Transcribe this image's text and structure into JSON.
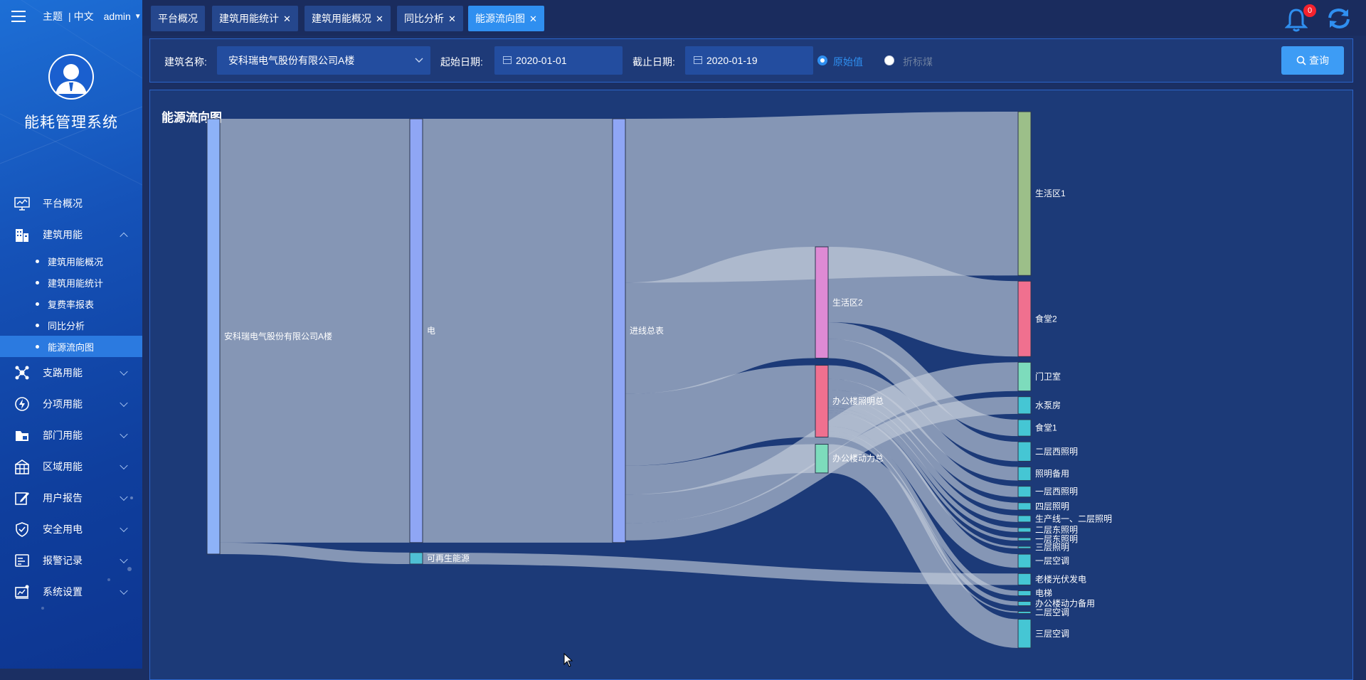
{
  "header": {
    "theme": "主题",
    "lang": "中文",
    "user": "admin",
    "tabs": [
      {
        "label": "平台概况",
        "closable": false
      },
      {
        "label": "建筑用能统计",
        "closable": true
      },
      {
        "label": "建筑用能概况",
        "closable": true
      },
      {
        "label": "同比分析",
        "closable": true
      },
      {
        "label": "能源流向图",
        "closable": true,
        "active": true
      }
    ],
    "notification_count": "0"
  },
  "sidebar": {
    "system_name": "能耗管理系统",
    "menu": [
      {
        "label": "平台概况",
        "icon": "monitor-icon"
      },
      {
        "label": "建筑用能",
        "icon": "building-icon",
        "expanded": true,
        "children": [
          "建筑用能概况",
          "建筑用能统计",
          "复费率报表",
          "同比分析",
          "能源流向图"
        ],
        "active_child": "能源流向图"
      },
      {
        "label": "支路用能",
        "icon": "branch-icon"
      },
      {
        "label": "分项用能",
        "icon": "lightning-icon"
      },
      {
        "label": "部门用能",
        "icon": "folder-icon"
      },
      {
        "label": "区域用能",
        "icon": "region-icon"
      },
      {
        "label": "用户报告",
        "icon": "edit-icon"
      },
      {
        "label": "安全用电",
        "icon": "shield-icon"
      },
      {
        "label": "报警记录",
        "icon": "alarm-icon"
      },
      {
        "label": "系统设置",
        "icon": "settings-icon"
      }
    ]
  },
  "filter": {
    "building_label": "建筑名称:",
    "building_value": "安科瑞电气股份有限公司A楼",
    "start_label": "起始日期:",
    "start_value": "2020-01-01",
    "end_label": "截止日期:",
    "end_value": "2020-01-19",
    "radio_raw": "原始值",
    "radio_coal": "折标煤",
    "selected_radio": "原始值",
    "query_button": "查询"
  },
  "colors": {
    "accent": "#2f8ff0",
    "panel_border": "#2b64c8",
    "link": "#c7cedb"
  },
  "chart_data": {
    "type": "sankey",
    "title": "能源流向图",
    "nodes": [
      {
        "name": "安科瑞电气股份有限公司A楼",
        "color": "#8db2f8"
      },
      {
        "name": "电",
        "color": "#8fa6f5"
      },
      {
        "name": "可再生能源",
        "color": "#4fc0d4"
      },
      {
        "name": "进线总表",
        "color": "#8fa6f5"
      },
      {
        "name": "生活区2",
        "color": "#de8ad4"
      },
      {
        "name": "办公楼照明总",
        "color": "#f0708f"
      },
      {
        "name": "办公楼动力总",
        "color": "#7ddcbc"
      },
      {
        "name": "生活区1",
        "color": "#9cbf89"
      },
      {
        "name": "食堂2",
        "color": "#f0708f"
      },
      {
        "name": "门卫室",
        "color": "#7ddcbc"
      },
      {
        "name": "水泵房",
        "color": "#45c6d4"
      },
      {
        "name": "食堂1",
        "color": "#45c6d4"
      },
      {
        "name": "二层西照明",
        "color": "#45c6d4"
      },
      {
        "name": "照明备用",
        "color": "#45c6d4"
      },
      {
        "name": "一层西照明",
        "color": "#45c6d4"
      },
      {
        "name": "四层照明",
        "color": "#45c6d4"
      },
      {
        "name": "生产线一、二层照明",
        "color": "#45c6d4"
      },
      {
        "name": "二层东照明",
        "color": "#45c6d4"
      },
      {
        "name": "一层东照明",
        "color": "#45c6d4"
      },
      {
        "name": "三层照明",
        "color": "#45c6d4"
      },
      {
        "name": "一层空调",
        "color": "#45c6d4"
      },
      {
        "name": "老楼光伏发电",
        "color": "#45c6d4"
      },
      {
        "name": "电梯",
        "color": "#45c6d4"
      },
      {
        "name": "办公楼动力备用",
        "color": "#45c6d4"
      },
      {
        "name": "二层空调",
        "color": "#45c6d4"
      },
      {
        "name": "三层空调",
        "color": "#45c6d4"
      }
    ],
    "links": [
      {
        "source": "安科瑞电气股份有限公司A楼",
        "target": "电",
        "value": 5900
      },
      {
        "source": "安科瑞电气股份有限公司A楼",
        "target": "可再生能源",
        "value": 160
      },
      {
        "source": "电",
        "target": "进线总表",
        "value": 5900
      },
      {
        "source": "进线总表",
        "target": "生活区1",
        "value": 2280
      },
      {
        "source": "进线总表",
        "target": "生活区2",
        "value": 1550
      },
      {
        "source": "进线总表",
        "target": "办公楼照明总",
        "value": 1000
      },
      {
        "source": "进线总表",
        "target": "办公楼动力总",
        "value": 400
      },
      {
        "source": "进线总表",
        "target": "门卫室",
        "value": 400
      },
      {
        "source": "进线总表",
        "target": "水泵房",
        "value": 240
      },
      {
        "source": "生活区2",
        "target": "食堂2",
        "value": 1050
      },
      {
        "source": "生活区2",
        "target": "食堂1",
        "value": 230
      },
      {
        "source": "生活区2",
        "target": "二层西照明",
        "value": 270
      },
      {
        "source": "办公楼照明总",
        "target": "照明备用",
        "value": 190
      },
      {
        "source": "办公楼照明总",
        "target": "一层西照明",
        "value": 150
      },
      {
        "source": "办公楼照明总",
        "target": "四层照明",
        "value": 100
      },
      {
        "source": "办公楼照明总",
        "target": "生产线一、二层照明",
        "value": 90
      },
      {
        "source": "办公楼照明总",
        "target": "二层东照明",
        "value": 60
      },
      {
        "source": "办公楼照明总",
        "target": "一层东照明",
        "value": 40
      },
      {
        "source": "办公楼照明总",
        "target": "三层照明",
        "value": 30
      },
      {
        "source": "办公楼照明总",
        "target": "一层空调",
        "value": 190
      },
      {
        "source": "办公楼照明总",
        "target": "电梯",
        "value": 70
      },
      {
        "source": "办公楼照明总",
        "target": "办公楼动力备用",
        "value": 60
      },
      {
        "source": "办公楼照明总",
        "target": "二层空调",
        "value": 20
      },
      {
        "source": "办公楼动力总",
        "target": "三层空调",
        "value": 400
      },
      {
        "source": "可再生能源",
        "target": "老楼光伏发电",
        "value": 160
      }
    ]
  }
}
